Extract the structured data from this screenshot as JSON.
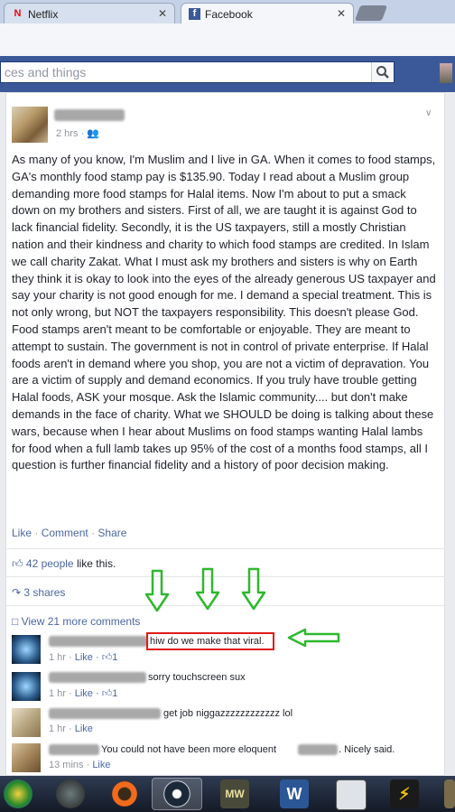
{
  "tabs": [
    {
      "label": "Netflix",
      "favicon": "netflix-icon",
      "color": "#e50914"
    },
    {
      "label": "Facebook",
      "favicon": "facebook-icon",
      "color": "#3b5998"
    }
  ],
  "search": {
    "value": "ces and things"
  },
  "post": {
    "time": "2 hrs ·",
    "body": "As many of you know, I'm Muslim and I live in GA. When it comes to food stamps, GA's monthly food stamp pay is $135.90. Today I read about a Muslim group demanding more food stamps for Halal items. Now I'm about to put a smack down on my brothers and sisters. First of all, we are taught it is against God to lack financial fidelity. Secondly, it is the US taxpayers, still a mostly Christian nation and their kindness and charity to which food stamps are credited. In Islam we call charity Zakat. What I must ask my brothers and sisters is why on Earth they think it is okay to look into the eyes of the already generous US taxpayer and say your charity is not good enough for me. I demand a special treatment. This is not only wrong, but NOT the taxpayers responsibility. This doesn't please God. Food stamps aren't meant to be comfortable or enjoyable. They are meant to attempt to sustain. The government is not in control of private enterprise. If Halal foods aren't in demand where you shop, you are not a victim of depravation. You are a victim of supply and demand economics. If you truly have trouble getting Halal foods, ASK your mosque. Ask the Islamic community.... but don't make demands in the face of charity. What we SHOULD be doing is talking about these wars, because when I hear about Muslims on food stamps wanting Halal lambs for food when a full lamb takes up 95% of the cost of a months food stamps, all I question is further financial fidelity and a history of poor decision making.",
    "actions": {
      "like": "Like",
      "comment": "Comment",
      "share": "Share",
      "dot": "·"
    }
  },
  "stats": {
    "likes_link": "42 people",
    "likes_suffix": "like this.",
    "shares": "3 shares",
    "view_more": "View 21 more comments"
  },
  "comments": [
    {
      "text": "hiw do we make that viral.",
      "time": "1 hr ·",
      "like": "Like ·",
      "likes": "1"
    },
    {
      "text": "sorry touchscreen sux",
      "time": "1 hr ·",
      "like": "Like ·",
      "likes": "1"
    },
    {
      "text": "get job niggazzzzzzzzzzzz lol",
      "time": "1 hr ·",
      "like": "Like"
    },
    {
      "text_a": "You could not have been more eloquent",
      "text_b": ". Nicely said.",
      "time": "13 mins ·",
      "like": "Like"
    }
  ],
  "taskbar": [
    {
      "icon": "start-orb-icon",
      "label": ""
    },
    {
      "icon": "media-app-icon",
      "label": ""
    },
    {
      "icon": "origin-icon",
      "label": ""
    },
    {
      "icon": "steam-icon",
      "label": ""
    },
    {
      "icon": "mw-game-icon",
      "label": "MW"
    },
    {
      "icon": "word-icon",
      "label": "W"
    },
    {
      "icon": "tool-app-icon",
      "label": ""
    },
    {
      "icon": "flash-icon",
      "label": ""
    }
  ],
  "colors": {
    "facebook_blue": "#3b5998",
    "link": "#4b67a1",
    "highlight": "#e01b1b",
    "arrow": "#2eb82e"
  }
}
